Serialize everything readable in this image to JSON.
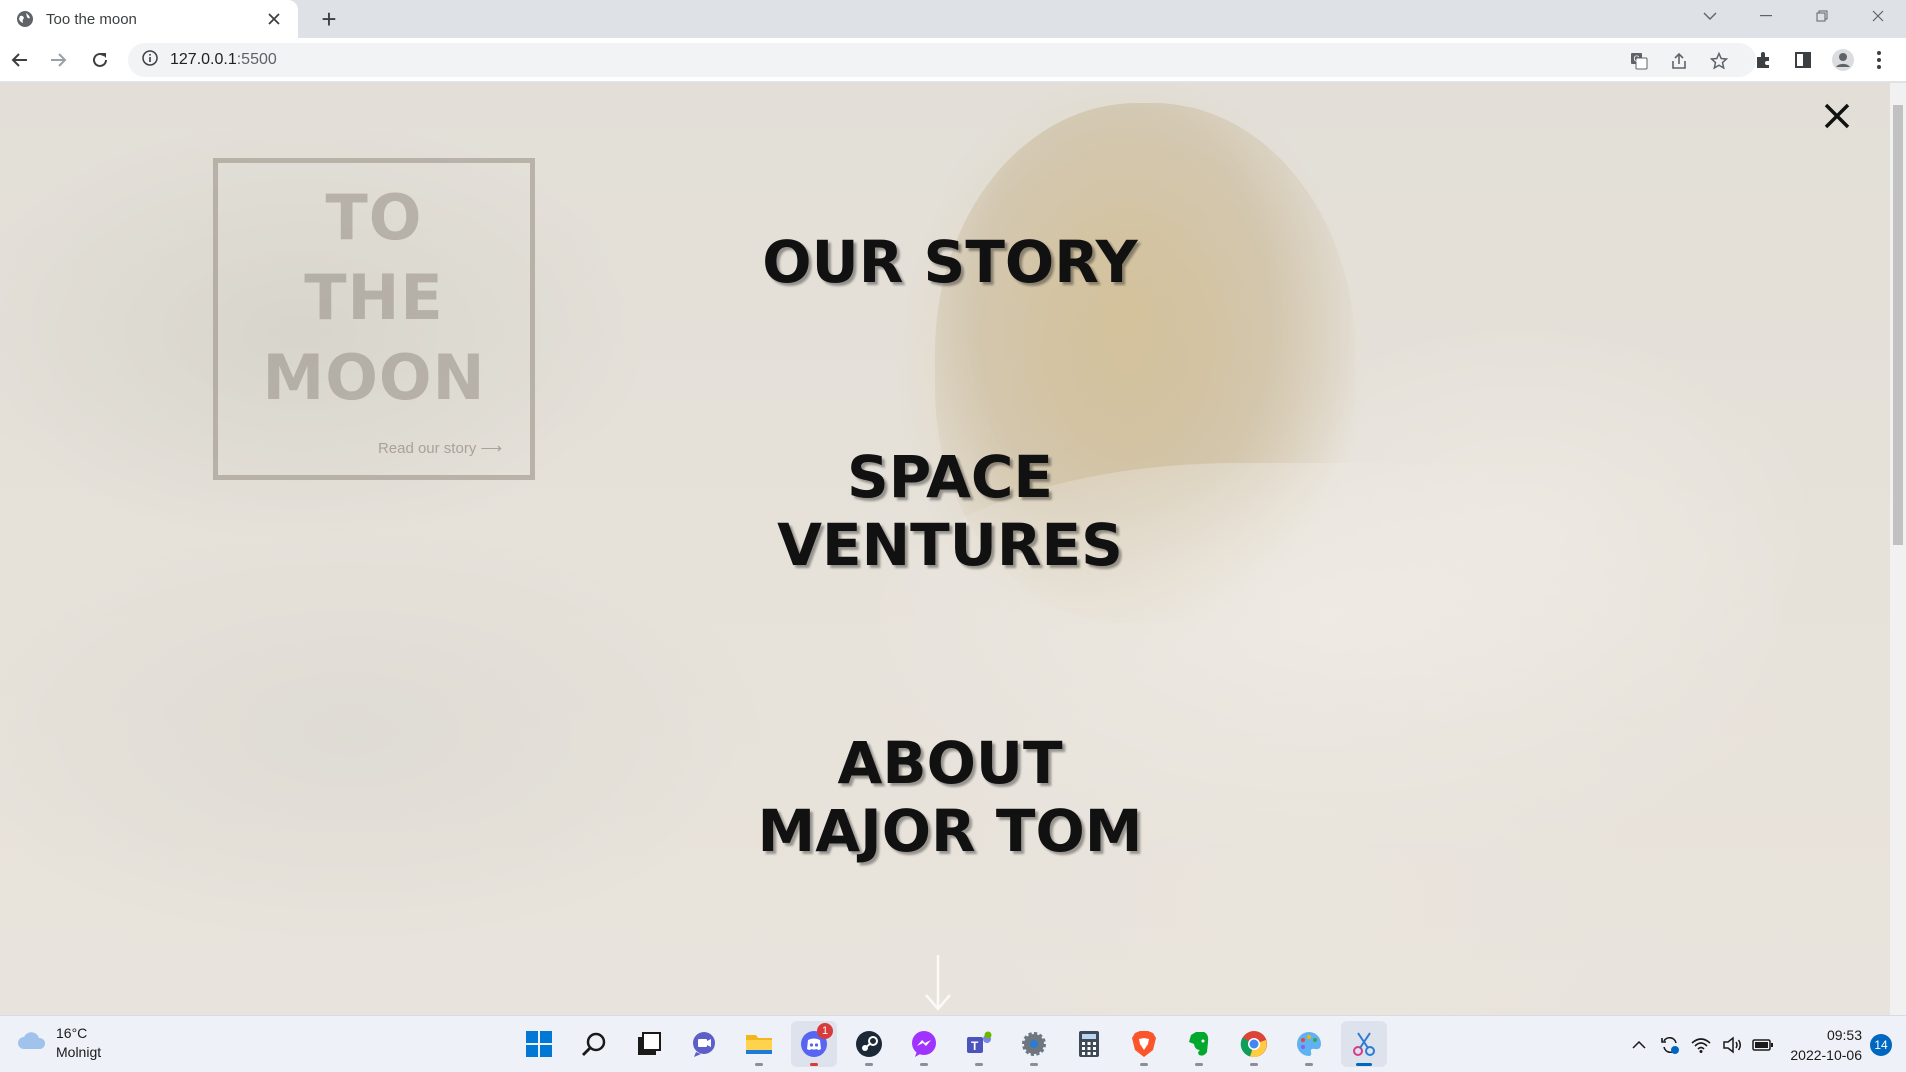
{
  "browser": {
    "tab_title": "Too the moon",
    "new_tab": "+",
    "url_host": "127.0.0.1",
    "url_port": ":5500"
  },
  "page": {
    "logo_lines": [
      "TO",
      "THE",
      "MOON"
    ],
    "logo_link": "Read our story ⟶",
    "menu": [
      {
        "line1": "OUR STORY",
        "line2": ""
      },
      {
        "line1": "SPACE",
        "line2": "VENTURES"
      },
      {
        "line1": "ABOUT",
        "line2": "MAJOR TOM"
      }
    ]
  },
  "taskbar": {
    "weather_temp": "16°C",
    "weather_desc": "Molnigt",
    "discord_badge": "1",
    "time": "09:53",
    "date": "2022-10-06",
    "notifications": "14"
  },
  "icons": {
    "taskbar_apps": [
      "windows-start-icon",
      "search-icon",
      "task-view-icon",
      "chat-icon",
      "file-explorer-icon",
      "discord-icon",
      "steam-icon",
      "messenger-icon",
      "teams-icon",
      "settings-icon",
      "calculator-icon",
      "brave-icon",
      "evernote-icon",
      "chrome-icon",
      "paint-icon",
      "snipping-tool-icon"
    ]
  },
  "colors": {
    "menu_text": "#111111",
    "accent": "#0067c0"
  }
}
